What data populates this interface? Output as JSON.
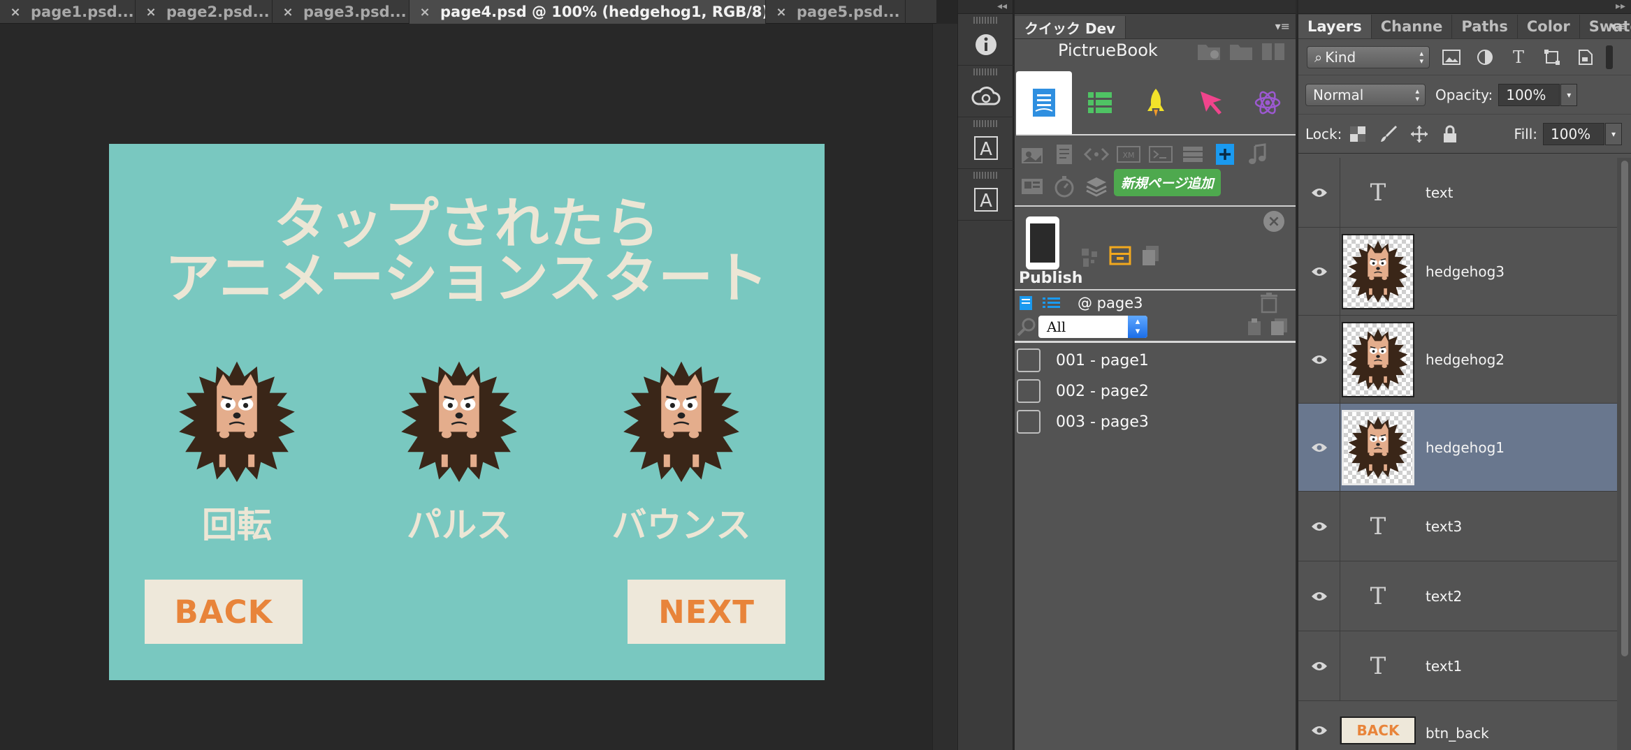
{
  "document_tabs": [
    {
      "label": "page1.psd...",
      "active": false
    },
    {
      "label": "page2.psd...",
      "active": false
    },
    {
      "label": "page3.psd...",
      "active": false
    },
    {
      "label": "page4.psd @ 100% (hedgehog1, RGB/8)",
      "active": true
    },
    {
      "label": "page5.psd...",
      "active": false
    }
  ],
  "tab_close_glyph": "×",
  "artboard": {
    "title_line1": "タップされたら",
    "title_line2": "アニメーションスタート",
    "captions": [
      "回転",
      "パルス",
      "バウンス"
    ],
    "back_label": "BACK",
    "next_label": "NEXT",
    "background": "#79c8c0",
    "button_text_color": "#e8843a"
  },
  "quick_dev": {
    "tab_label": "クイック Dev",
    "app_title": "PictrueBook",
    "tooltip": "新規ページ追加",
    "publish_label": "Publish",
    "current_page": "@ page3",
    "filter_value": "All",
    "pages": [
      "001 - page1",
      "002 - page2",
      "003 - page3"
    ]
  },
  "layers_panel": {
    "tabs": [
      "Layers",
      "Channe",
      "Paths",
      "Color",
      "Swatch"
    ],
    "kind_label": "Kind",
    "blend_mode": "Normal",
    "opacity_label": "Opacity:",
    "opacity_value": "100%",
    "lock_label": "Lock:",
    "fill_label": "Fill:",
    "fill_value": "100%",
    "layers": [
      {
        "name": "text",
        "kind": "text",
        "selected": false
      },
      {
        "name": "hedgehog3",
        "kind": "image",
        "selected": false
      },
      {
        "name": "hedgehog2",
        "kind": "image",
        "selected": false
      },
      {
        "name": "hedgehog1",
        "kind": "image",
        "selected": true
      },
      {
        "name": "text3",
        "kind": "text",
        "selected": false
      },
      {
        "name": "text2",
        "kind": "text",
        "selected": false
      },
      {
        "name": "text1",
        "kind": "text",
        "selected": false
      },
      {
        "name": "btn_back",
        "kind": "button",
        "thumb_text": "BACK",
        "selected": false
      }
    ],
    "text_glyph": "T"
  }
}
